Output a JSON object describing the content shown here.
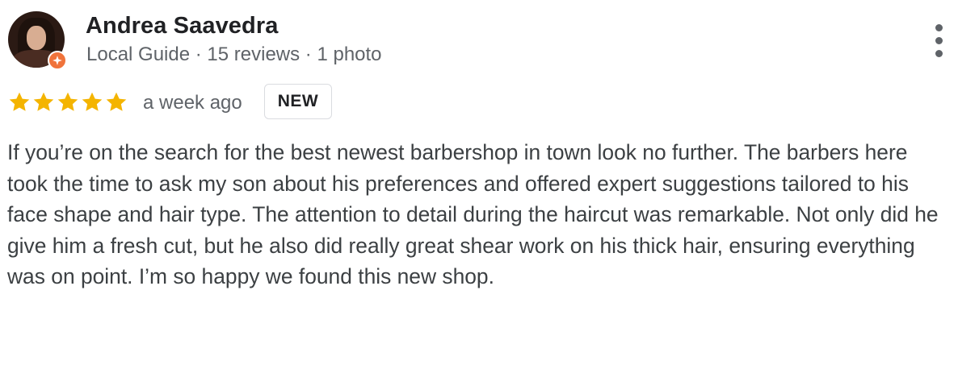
{
  "review": {
    "author": {
      "name": "Andrea Saavedra",
      "meta": "Local Guide · 15 reviews · 1 photo"
    },
    "rating": 5,
    "rating_color": "#f4b400",
    "time": "a week ago",
    "badge": "NEW",
    "text": "If you’re on the search for the best newest barbershop in town look no further. The barbers here took the time to ask my son about his preferences and offered expert suggestions tailored to his face shape and hair type. The attention to detail during the haircut was remarkable. Not only did he give him a fresh cut, but he also did really great shear work on his thick hair, ensuring everything was on point. I’m so happy we found this new shop."
  },
  "icons": {
    "avatar": "profile-photo",
    "guide_badge": "local-guide-badge-icon",
    "more": "more-vert-icon",
    "star": "star-icon"
  },
  "colors": {
    "guide_badge": "#f0733b",
    "secondary_text": "#5f6368"
  }
}
